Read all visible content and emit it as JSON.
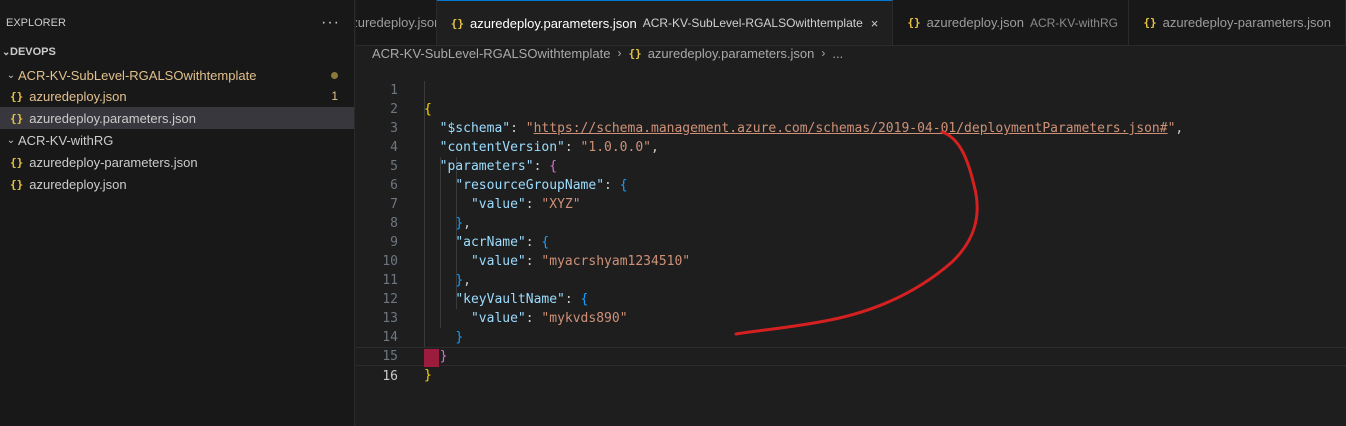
{
  "sidebar": {
    "title": "EXPLORER",
    "more": "···",
    "section": "DEVOPS",
    "folders": [
      {
        "name": "ACR-KV-SubLevel-RGALSOwithtemplate",
        "files": [
          {
            "name": "azuredeploy.json",
            "badge": "1"
          },
          {
            "name": "azuredeploy.parameters.json",
            "badge": ""
          }
        ]
      },
      {
        "name": "ACR-KV-withRG",
        "files": [
          {
            "name": "azuredeploy-parameters.json",
            "badge": ""
          },
          {
            "name": "azuredeploy.json",
            "badge": ""
          }
        ]
      }
    ]
  },
  "tabs": [
    {
      "label": "azuredeploy.json",
      "desc": ".\\"
    },
    {
      "label": "azuredeploy.parameters.json",
      "desc": "ACR-KV-SubLevel-RGALSOwithtemplate",
      "close": "×"
    },
    {
      "label": "azuredeploy.json",
      "desc": "ACR-KV-withRG"
    },
    {
      "label": "azuredeploy-parameters.json",
      "desc": ""
    }
  ],
  "breadcrumb": {
    "folder": "ACR-KV-SubLevel-RGALSOwithtemplate",
    "file": "azuredeploy.parameters.json",
    "more": "..."
  },
  "icons": {
    "json": "{}",
    "chevron": "›"
  },
  "editor": {
    "line_numbers": [
      "1",
      "2",
      "3",
      "4",
      "5",
      "6",
      "7",
      "8",
      "9",
      "10",
      "11",
      "12",
      "13",
      "14",
      "15",
      "16"
    ],
    "schema_key": "\"$schema\"",
    "schema_q1": "\"",
    "schema_url": "https://schema.management.azure.com/schemas/2019-04-01/deploymentParameters.json#",
    "schema_q2": "\"",
    "cv_key": "\"contentVersion\"",
    "cv_val": "\"1.0.0.0\"",
    "params_key": "\"parameters\"",
    "rg_key": "\"resourceGroupName\"",
    "value_key": "\"value\"",
    "rg_val": "\"XYZ\"",
    "acr_key": "\"acrName\"",
    "acr_val": "\"myacrshyam1234510\"",
    "kv_key": "\"keyVaultName\"",
    "kv_val": "\"mykvds890\""
  },
  "colors": {
    "accent": "#0078d4",
    "annotation": "#d42020",
    "cursor": "#9b1c3c"
  }
}
